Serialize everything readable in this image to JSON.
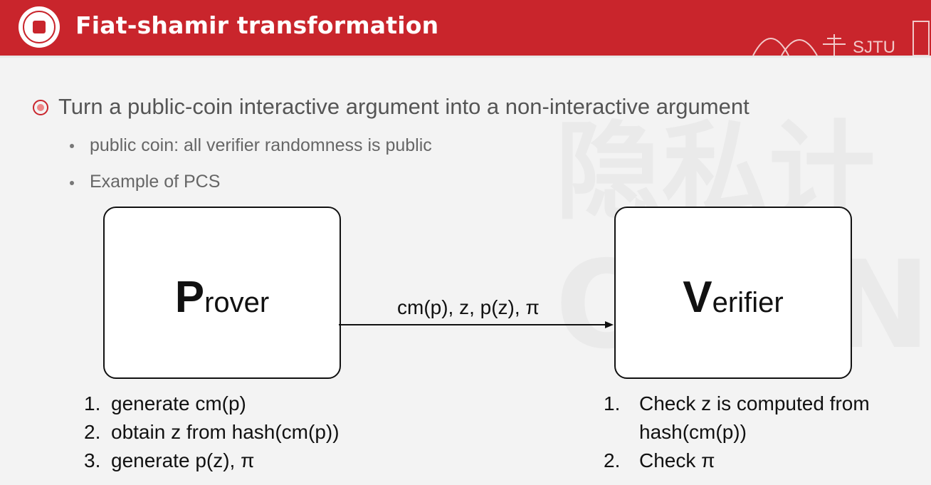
{
  "header": {
    "title": "Fiat-shamir transformation",
    "campus_text": "SJTU"
  },
  "content": {
    "main_bullet": "Turn a public-coin interactive argument into a non-interactive argument",
    "sub_bullets": [
      "public coin: all verifier randomness is public",
      "Example of PCS"
    ]
  },
  "diagram": {
    "prover": {
      "initial": "P",
      "rest": "rover"
    },
    "verifier": {
      "initial": "V",
      "rest": "erifier"
    },
    "message": "cm(p), z, p(z), π",
    "prover_steps": [
      {
        "num": "1.",
        "text": "generate cm(p)"
      },
      {
        "num": "2.",
        "text": "obtain z from hash(cm(p))"
      },
      {
        "num": "3.",
        "text": "generate p(z), π"
      }
    ],
    "verifier_steps": [
      {
        "num": "1.",
        "text": "Check z is computed from"
      },
      {
        "num": "",
        "text": "hash(cm(p))"
      },
      {
        "num": "2.",
        "text": "Check π"
      }
    ]
  },
  "watermark": {
    "line1": "隐私计",
    "line2": "OPEN"
  },
  "colors": {
    "header_red": "#c9252c",
    "background": "#f3f3f3"
  }
}
